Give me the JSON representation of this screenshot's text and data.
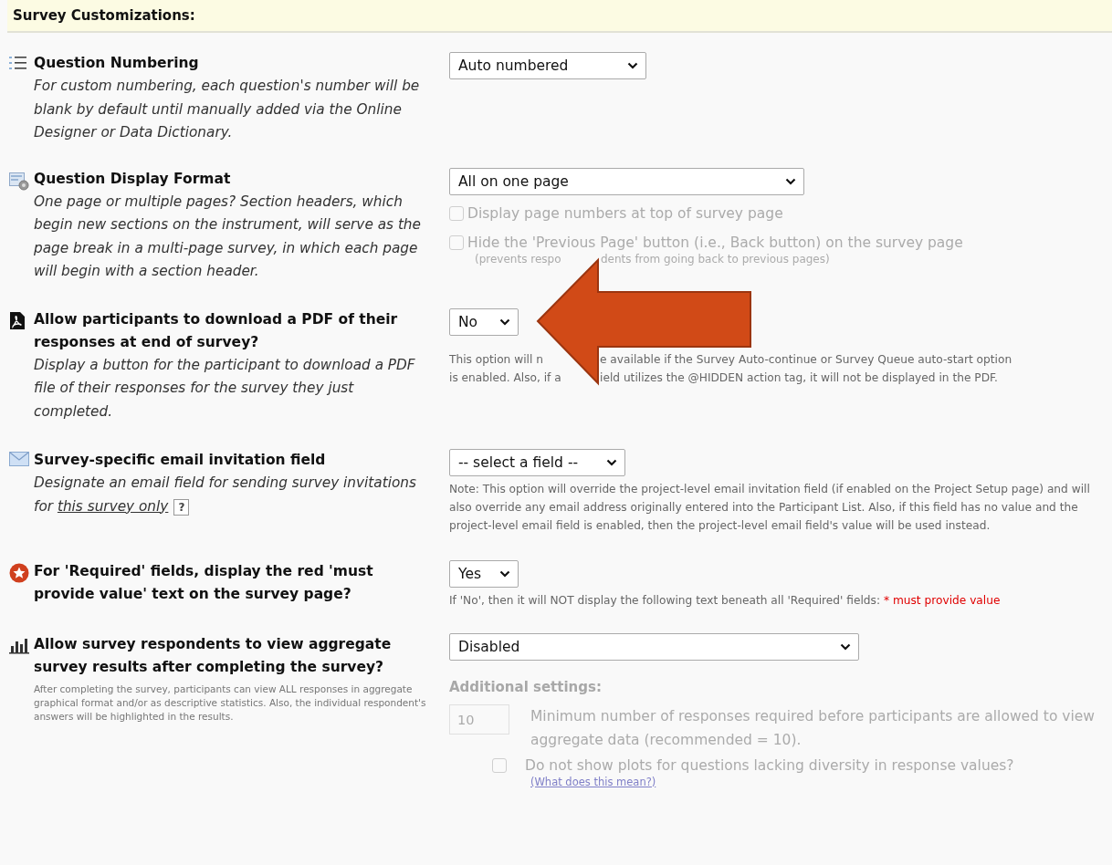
{
  "section_title": "Survey Customizations:",
  "settings": [
    {
      "title": "Question Numbering",
      "description": "For custom numbering, each question's number will be blank by default until manually added via the Online Designer or Data Dictionary.",
      "select": "Auto numbered"
    },
    {
      "title": "Question Display Format",
      "description": "One page or multiple pages? Section headers, which begin new sections on the instrument, will serve as the page break in a multi-page survey, in which each page will begin with a section header.",
      "select": "All on one page",
      "checkboxes": [
        {
          "label": "Display page numbers at top of survey page",
          "checked": false,
          "disabled": true
        },
        {
          "label": "Hide the 'Previous Page' button (i.e., Back button) on the survey page",
          "checked": false,
          "disabled": true,
          "subnote": [
            "(prevents respo",
            "dents from going back to previous pages)"
          ]
        }
      ]
    },
    {
      "title": "Allow participants to download a PDF of their responses at end of survey?",
      "description": "Display a button for the participant to download a PDF file of their responses for the survey they just completed.",
      "select": "No",
      "note_lines": [
        [
          "This option will n",
          "e available if the Survey Auto-continue or Survey Queue auto-start option"
        ],
        [
          "is enabled. Also, if a",
          "ield utilizes the @HIDDEN action tag, it will not be displayed in the PDF."
        ]
      ]
    },
    {
      "title": "Survey-specific email invitation field",
      "description": "Designate an email field for sending survey invitations for",
      "link": "this survey only",
      "help": "?",
      "select": "-- select a field --",
      "note": "Note: This option will override the project-level email invitation field (if enabled on the Project Setup page) and will also override any email address originally entered into the Participant List. Also, if this field has no value and the project-level email field is enabled, then the project-level email field's value will be used instead."
    },
    {
      "title": "For 'Required' fields, display the red 'must provide value' text on the survey page?",
      "select": "Yes",
      "note": "If 'No', then it will NOT display the following text beneath all 'Required' fields:",
      "note_required": "* must provide value"
    },
    {
      "title": "Allow survey respondents to view aggregate survey results after completing the survey?",
      "description": "After completing the survey, participants can view ALL responses in aggregate graphical format and/or as descriptive statistics. Also, the individual respondent's answers will be highlighted in the results.",
      "select": "Disabled",
      "additional": {
        "heading": "Additional settings:",
        "min_value": "10",
        "min_label": "Minimum number of responses required before participants are allowed to view aggregate data (recommended = 10).",
        "diversity_label": "Do not show plots for questions lacking diversity in response values?",
        "diversity_checked": false,
        "disabled": true,
        "help_link": "(What does this mean?)"
      }
    }
  ],
  "annotation": {
    "kind": "arrow",
    "color": "#d14a17"
  }
}
